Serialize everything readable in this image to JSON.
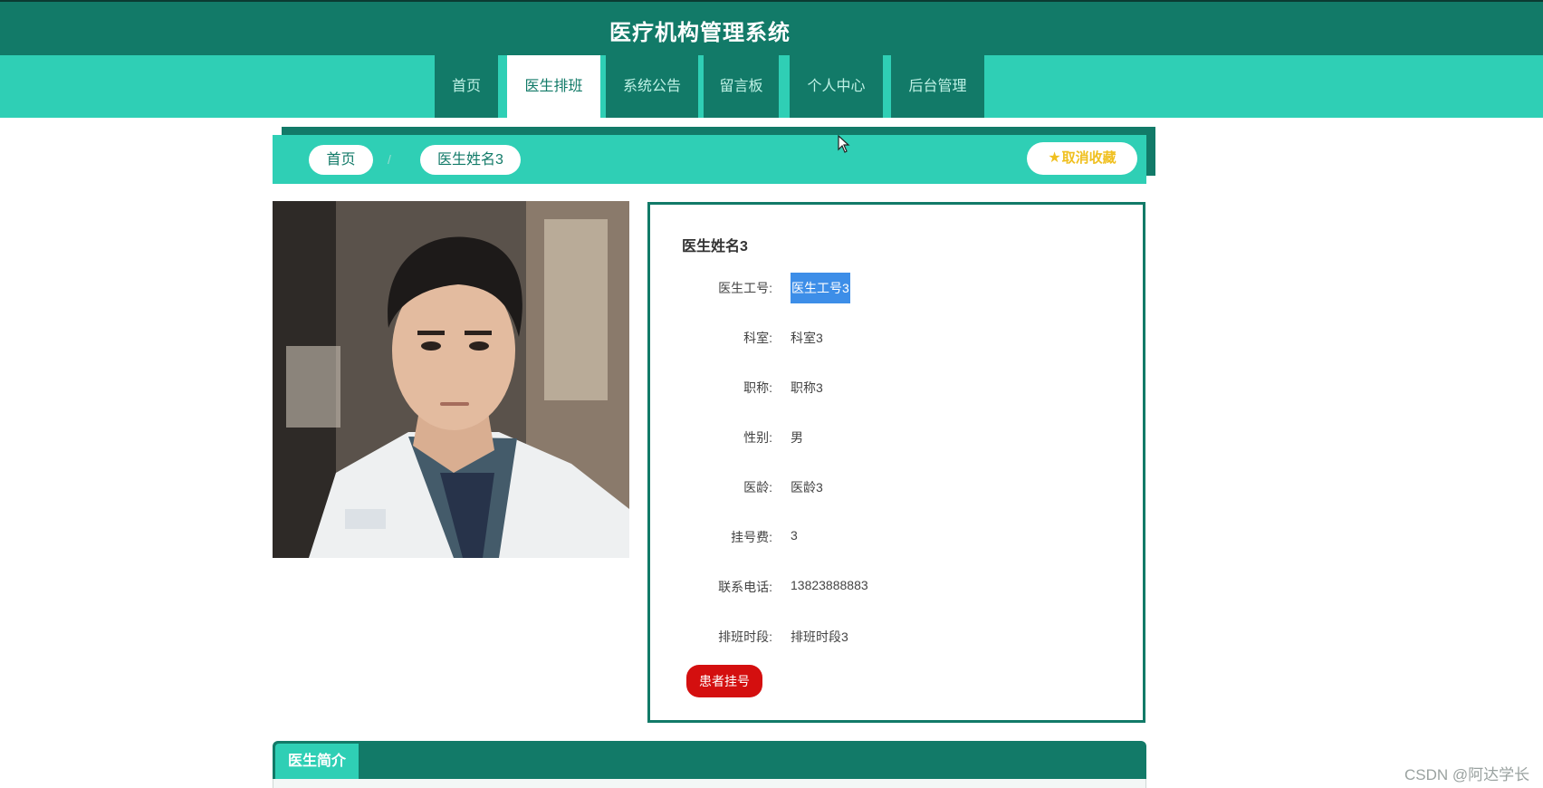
{
  "header": {
    "title": "医疗机构管理系统"
  },
  "nav": {
    "items": [
      {
        "label": "首页"
      },
      {
        "label": "医生排班"
      },
      {
        "label": "系统公告"
      },
      {
        "label": "留言板"
      },
      {
        "label": "个人中心"
      },
      {
        "label": "后台管理"
      }
    ],
    "active_index": 1
  },
  "breadcrumb": {
    "home": "首页",
    "current": "医生姓名3",
    "favorite_button": "取消收藏"
  },
  "doctor": {
    "name": "医生姓名3",
    "fields": [
      {
        "label": "医生工号:",
        "value": "医生工号3"
      },
      {
        "label": "科室:",
        "value": "科室3"
      },
      {
        "label": "职称:",
        "value": "职称3"
      },
      {
        "label": "性别:",
        "value": "男"
      },
      {
        "label": "医龄:",
        "value": "医龄3"
      },
      {
        "label": "挂号费:",
        "value": "3"
      },
      {
        "label": "联系电话:",
        "value": "13823888883"
      },
      {
        "label": "排班时段:",
        "value": "排班时段3"
      }
    ],
    "register_button": "患者挂号"
  },
  "intro": {
    "tab_label": "医生简介"
  },
  "watermark": "CSDN @阿达学长",
  "colors": {
    "primary_dark": "#127a68",
    "primary_light": "#2fcfb5",
    "danger": "#d40f0f",
    "favorite": "#f0c020",
    "selection": "#3d8ee8"
  }
}
